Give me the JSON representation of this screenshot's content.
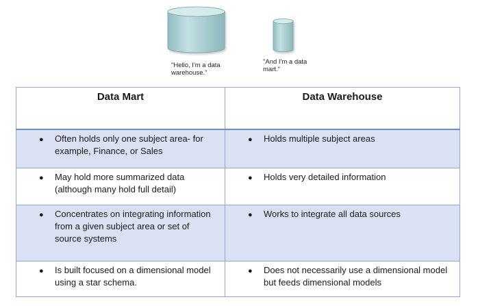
{
  "illustration": {
    "warehouse_caption": "\"Hello, I'm a data warehouse.\"",
    "mart_caption": "\"And I'm a data mart.\"",
    "cylinder_color": "#a9cfd3"
  },
  "table": {
    "headers": [
      "Data Mart",
      "Data Warehouse"
    ],
    "rows": [
      {
        "mart": "Often holds only one subject area- for example, Finance, or Sales",
        "warehouse": "Holds multiple subject areas"
      },
      {
        "mart": "May hold more summarized data (although many hold full detail)",
        "warehouse": "Holds very detailed information"
      },
      {
        "mart": "Concentrates on integrating information from a given subject area or set of source systems",
        "warehouse": "Works to integrate all data sources"
      },
      {
        "mart": "Is built focused on a dimensional model using a star schema.",
        "warehouse": "Does not necessarily use a dimensional model but feeds dimensional models"
      }
    ],
    "band_color": "#d9e1f2",
    "border_color": "#8ea9cf"
  }
}
